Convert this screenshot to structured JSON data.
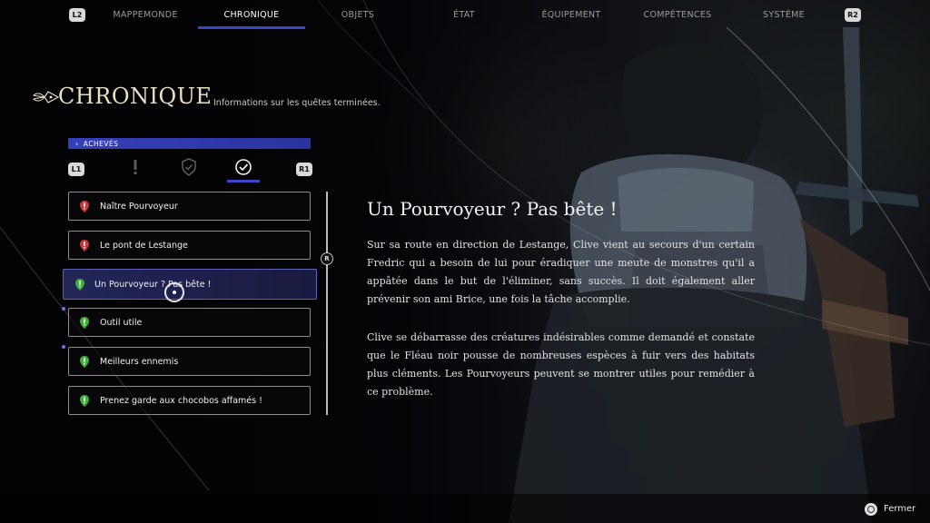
{
  "nav": {
    "left_hint": "L2",
    "right_hint": "R2",
    "tabs": [
      {
        "label": "MAPPEMONDE"
      },
      {
        "label": "CHRONIQUE"
      },
      {
        "label": "OBJETS"
      },
      {
        "label": "ÉTAT"
      },
      {
        "label": "ÉQUIPEMENT"
      },
      {
        "label": "COMPÉTENCES"
      },
      {
        "label": "SYSTÈME"
      }
    ],
    "active_tab": "CHRONIQUE"
  },
  "header": {
    "title": "CHRONIQUE",
    "subtitle": "Informations sur les quêtes terminées."
  },
  "category": {
    "label": "ACHEVÉS"
  },
  "filters": {
    "left_hint": "L1",
    "right_hint": "R1",
    "icons": [
      "exclamation-icon",
      "shield-check-icon",
      "circle-check-icon"
    ],
    "active": "circle-check-icon"
  },
  "quests": [
    {
      "label": "Naître Pourvoyeur",
      "icon": "red-quest-marker-icon",
      "color": "#c8383a"
    },
    {
      "label": "Le pont de Lestange",
      "icon": "red-quest-marker-icon",
      "color": "#c8383a"
    },
    {
      "label": "Un Pourvoyeur ? Pas bête !",
      "icon": "green-quest-marker-icon",
      "color": "#3fae3a"
    },
    {
      "label": "Outil utile",
      "icon": "green-quest-marker-icon",
      "color": "#3fae3a"
    },
    {
      "label": "Meilleurs ennemis",
      "icon": "green-quest-marker-icon",
      "color": "#3fae3a"
    },
    {
      "label": "Prenez garde aux chocobos affamés !",
      "icon": "green-quest-marker-icon",
      "color": "#3fae3a"
    }
  ],
  "selected_quest": "Un Pourvoyeur ? Pas bête !",
  "scroll_hint": "R",
  "detail": {
    "title": "Un Pourvoyeur ? Pas bête !",
    "paragraph1": "Sur sa route en direction de Lestange, Clive vient au secours d'un certain Fredric qui a besoin de lui pour éradiquer une meute de monstres qu'il a appâtée dans le but de l'éliminer, sans succès. Il doit également aller prévenir son ami Brice, une fois la tâche accomplie.",
    "paragraph2": "Clive se débarrasse des créatures indésirables comme demandé et constate que le Fléau noir pousse de nombreuses espèces à fuir vers des habitats plus cléments. Les Pourvoyeurs peuvent se montrer utiles pour remédier à ce problème."
  },
  "footer": {
    "close_label": "Fermer"
  },
  "colors": {
    "accent": "#3b46c6",
    "title_gold": "#e9dfc4"
  }
}
